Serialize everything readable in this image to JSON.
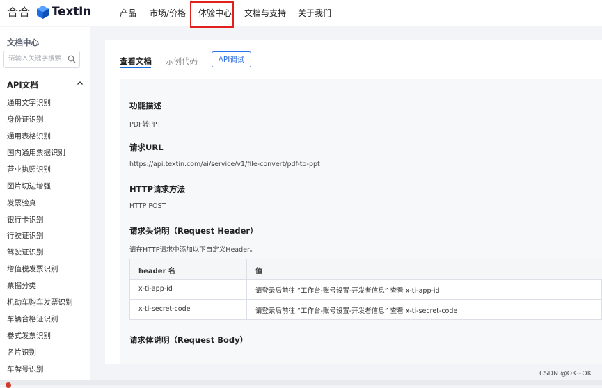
{
  "topbar": {
    "brand_icons": [
      "合",
      "合"
    ],
    "logo_text": "TextIn",
    "nav": [
      "产品",
      "市场/价格",
      "体验中心",
      "文档与支持",
      "关于我们"
    ],
    "highlighted_nav": "体验中心",
    "accent_color": "#1b6ee0",
    "highlight_color": "#e0201b"
  },
  "sidebar": {
    "title": "文档中心",
    "search_placeholder": "请输入关键字搜索",
    "section_label": "API文档",
    "items": [
      "通用文字识别",
      "身份证识别",
      "通用表格识别",
      "国内通用票据识别",
      "营业执照识别",
      "图片切边增强",
      "发票验真",
      "银行卡识别",
      "行驶证识别",
      "驾驶证识别",
      "增值税发票识别",
      "票据分类",
      "机动车购车发票识别",
      "车辆合格证识别",
      "卷式发票识别",
      "名片识别",
      "车牌号识别"
    ]
  },
  "main": {
    "tabs": {
      "active": "查看文档",
      "inactive": "示例代码",
      "button": "API调试"
    },
    "doc": {
      "func_title": "功能描述",
      "func_value": "PDF转PPT",
      "url_title": "请求URL",
      "url_value": "https://api.textin.com/ai/service/v1/file-convert/pdf-to-ppt",
      "method_title": "HTTP请求方法",
      "method_value": "HTTP POST",
      "header_title": "请求头说明（Request Header）",
      "header_desc": "请在HTTP请求中添加以下自定义Header。",
      "table": {
        "headers": [
          "header 名",
          "值"
        ],
        "rows": [
          [
            "x-ti-app-id",
            "请登录后前往 “工作台-账号设置-开发者信息” 查看 x-ti-app-id"
          ],
          [
            "x-ti-secret-code",
            "请登录后前往 “工作台-账号设置-开发者信息” 查看 x-ti-secret-code"
          ]
        ]
      },
      "body_title": "请求体说明（Request Body）"
    }
  },
  "watermark": "CSDN @OK~OK"
}
